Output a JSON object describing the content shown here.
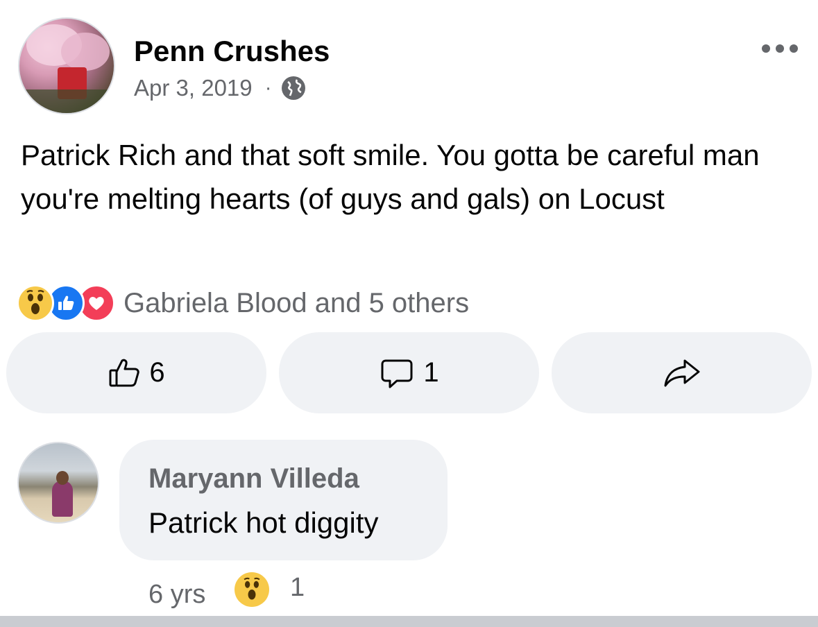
{
  "post": {
    "page_name": "Penn Crushes",
    "date": "Apr 3, 2019",
    "separator": "·",
    "privacy_icon": "globe-icon",
    "text": "Patrick Rich and that soft smile. You gotta be careful man you're melting hearts (of guys and gals) on Locust",
    "reaction_icons": [
      "wow-icon",
      "like-icon",
      "love-icon"
    ],
    "reaction_summary": "Gabriela Blood and 5 others"
  },
  "actions": {
    "like_count": "6",
    "comment_count": "1",
    "share_icon": "share-arrow-icon"
  },
  "comment": {
    "author": "Maryann Villeda",
    "text": "Patrick hot diggity",
    "time": "6 yrs",
    "reaction_icon": "wow-icon",
    "reaction_count": "1"
  },
  "colors": {
    "primary_text": "#050505",
    "secondary_text": "#65676b",
    "button_bg": "#f0f2f5",
    "like_blue": "#1877f2",
    "love_red": "#f33e58",
    "wow_yellow": "#f7c949"
  }
}
